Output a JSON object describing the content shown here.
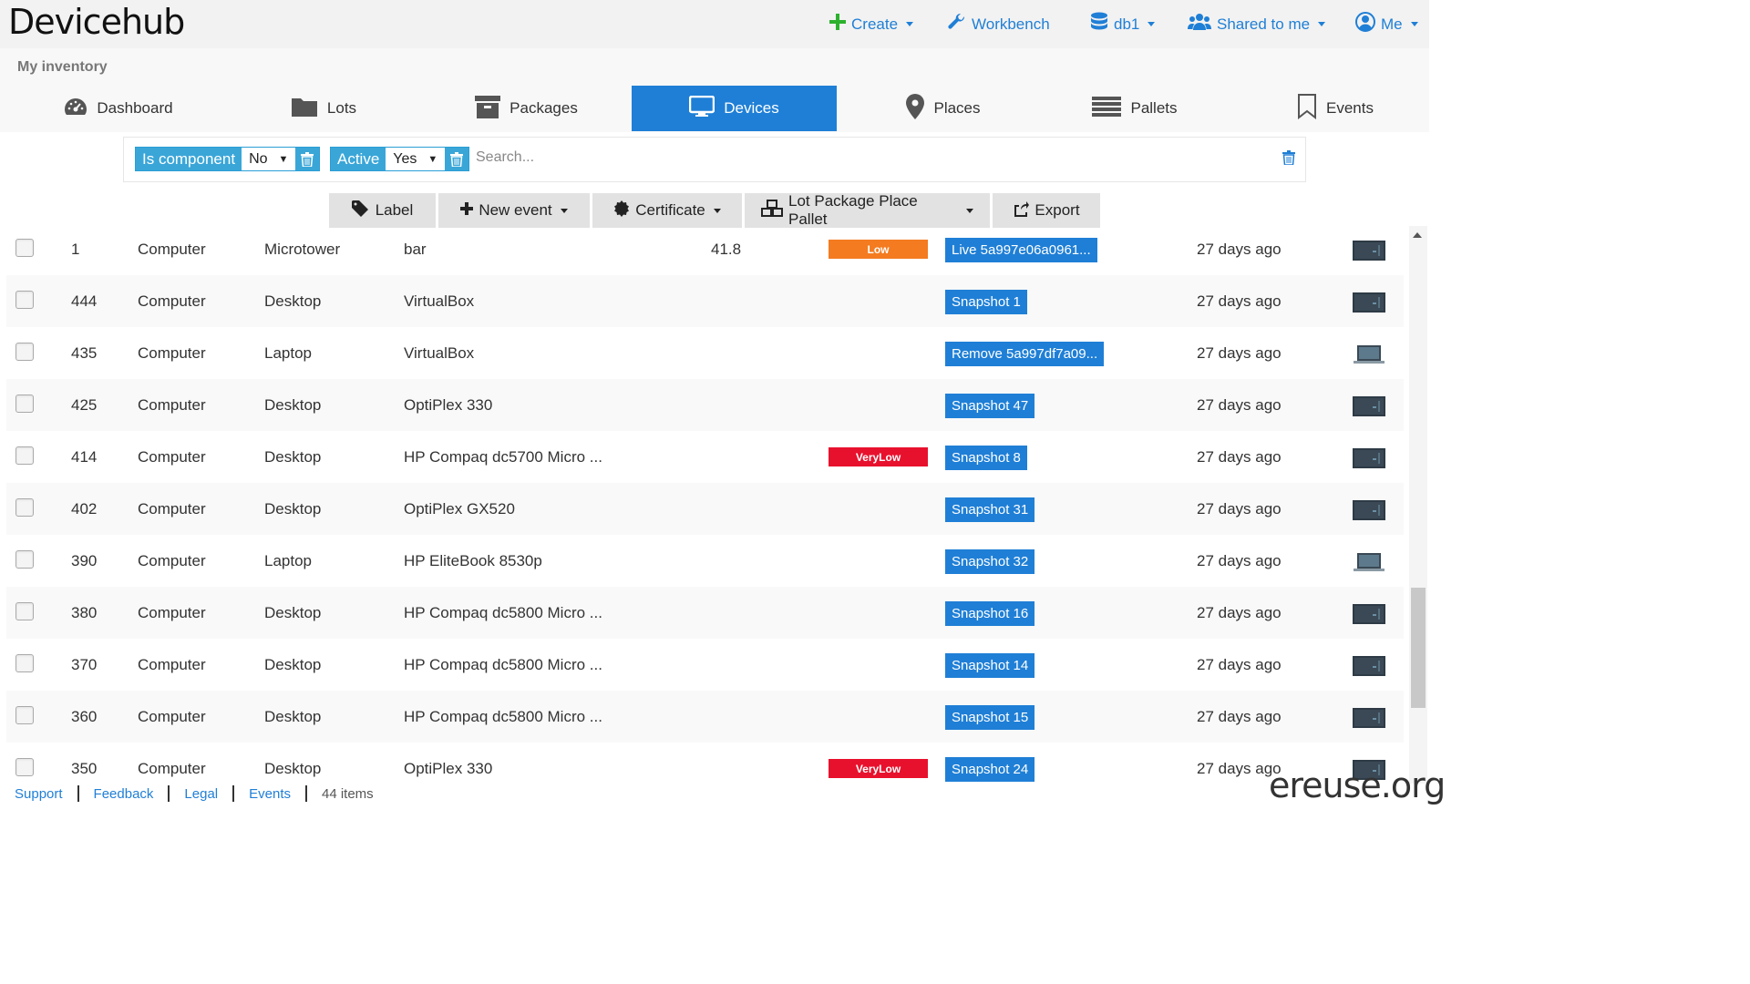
{
  "app": {
    "logo": "Devicehub",
    "brand": "ereuse.org"
  },
  "topnav": {
    "create": "Create",
    "workbench": "Workbench",
    "db": "db1",
    "shared": "Shared to me",
    "me": "Me"
  },
  "inventory_title": "My inventory",
  "tabs": [
    "Dashboard",
    "Lots",
    "Packages",
    "Devices",
    "Places",
    "Pallets",
    "Events"
  ],
  "filters": {
    "is_component_label": "Is component",
    "is_component_value": "No",
    "active_label": "Active",
    "active_value": "Yes",
    "search_placeholder": "Search..."
  },
  "toolbar": {
    "label": "Label",
    "new_event": "New event",
    "certificate": "Certificate",
    "lot_package": "Lot Package Place Pallet",
    "export": "Export"
  },
  "rows": [
    {
      "id": "1",
      "type": "Computer",
      "subtype": "Microtower",
      "model": "bar",
      "score": "41.8",
      "rating": "Low",
      "rating_color": "#f47b20",
      "event": "Live 5a997e06a0961...",
      "time": "27 days ago",
      "icon": "desktop-icon"
    },
    {
      "id": "444",
      "type": "Computer",
      "subtype": "Desktop",
      "model": "VirtualBox",
      "score": "",
      "rating": "",
      "rating_color": "",
      "event": "Snapshot 1",
      "time": "27 days ago",
      "icon": "desktop-icon"
    },
    {
      "id": "435",
      "type": "Computer",
      "subtype": "Laptop",
      "model": "VirtualBox",
      "score": "",
      "rating": "",
      "rating_color": "",
      "event": "Remove 5a997df7a09...",
      "time": "27 days ago",
      "icon": "laptop-icon"
    },
    {
      "id": "425",
      "type": "Computer",
      "subtype": "Desktop",
      "model": "OptiPlex 330",
      "score": "",
      "rating": "",
      "rating_color": "",
      "event": "Snapshot 47",
      "time": "27 days ago",
      "icon": "desktop-icon"
    },
    {
      "id": "414",
      "type": "Computer",
      "subtype": "Desktop",
      "model": "HP Compaq dc5700 Micro ...",
      "score": "",
      "rating": "VeryLow",
      "rating_color": "#e8112d",
      "event": "Snapshot 8",
      "time": "27 days ago",
      "icon": "desktop-icon"
    },
    {
      "id": "402",
      "type": "Computer",
      "subtype": "Desktop",
      "model": "OptiPlex GX520",
      "score": "",
      "rating": "",
      "rating_color": "",
      "event": "Snapshot 31",
      "time": "27 days ago",
      "icon": "desktop-icon"
    },
    {
      "id": "390",
      "type": "Computer",
      "subtype": "Laptop",
      "model": "HP EliteBook 8530p",
      "score": "",
      "rating": "",
      "rating_color": "",
      "event": "Snapshot 32",
      "time": "27 days ago",
      "icon": "laptop-icon"
    },
    {
      "id": "380",
      "type": "Computer",
      "subtype": "Desktop",
      "model": "HP Compaq dc5800 Micro ...",
      "score": "",
      "rating": "",
      "rating_color": "",
      "event": "Snapshot 16",
      "time": "27 days ago",
      "icon": "desktop-icon"
    },
    {
      "id": "370",
      "type": "Computer",
      "subtype": "Desktop",
      "model": "HP Compaq dc5800 Micro ...",
      "score": "",
      "rating": "",
      "rating_color": "",
      "event": "Snapshot 14",
      "time": "27 days ago",
      "icon": "desktop-icon"
    },
    {
      "id": "360",
      "type": "Computer",
      "subtype": "Desktop",
      "model": "HP Compaq dc5800 Micro ...",
      "score": "",
      "rating": "",
      "rating_color": "",
      "event": "Snapshot 15",
      "time": "27 days ago",
      "icon": "desktop-icon"
    },
    {
      "id": "350",
      "type": "Computer",
      "subtype": "Desktop",
      "model": "OptiPlex 330",
      "score": "",
      "rating": "VeryLow",
      "rating_color": "#e8112d",
      "event": "Snapshot 24",
      "time": "27 days ago",
      "icon": "desktop-icon"
    }
  ],
  "footer": {
    "support": "Support",
    "feedback": "Feedback",
    "legal": "Legal",
    "events": "Events",
    "count": "44 items"
  },
  "colors": {
    "primary": "#1f7fd6",
    "chip": "#2a9fd6",
    "create_green": "#2cb12c"
  }
}
